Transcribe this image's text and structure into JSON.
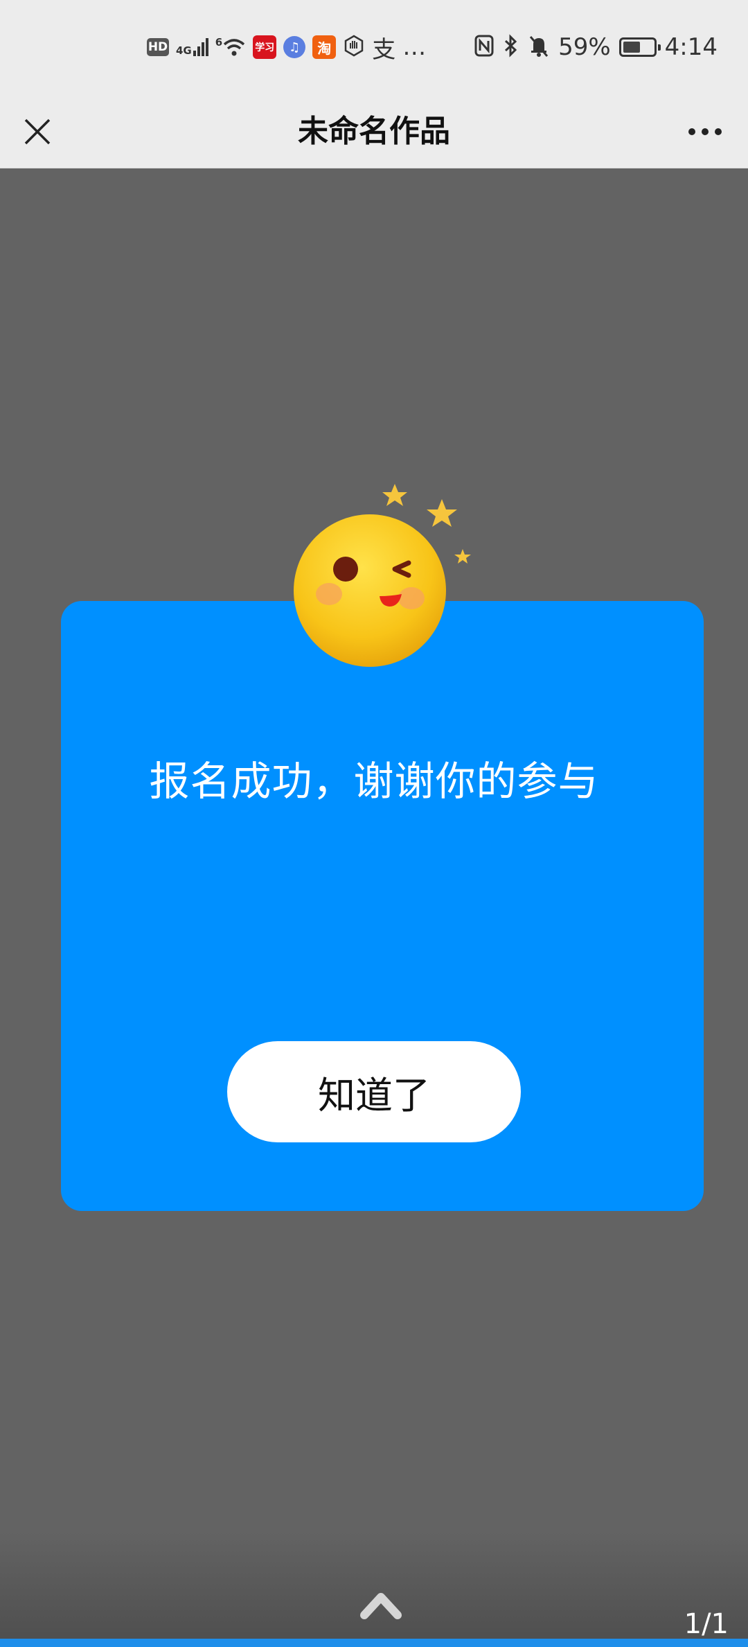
{
  "status_bar": {
    "left_icons": [
      "hd-icon",
      "4g-signal-icon",
      "6g-wifi-icon",
      "app-xuexi-icon",
      "app-music-icon",
      "app-taobao-icon",
      "app-hand-icon",
      "app-zhi-icon"
    ],
    "hd_label": "HD",
    "signal_label": "4G",
    "wifi_label": "6",
    "xuexi_label": "学习",
    "taobao_label": "淘",
    "zhi_label": "支",
    "more": "…",
    "battery_percent": "59%",
    "battery_level": 0.59,
    "time": "4:14"
  },
  "title_bar": {
    "title": "未命名作品"
  },
  "dialog": {
    "message": "报名成功，谢谢你的参与",
    "button_label": "知道了",
    "card_color": "#0090ff"
  },
  "footer": {
    "page_counter": "1/1"
  }
}
